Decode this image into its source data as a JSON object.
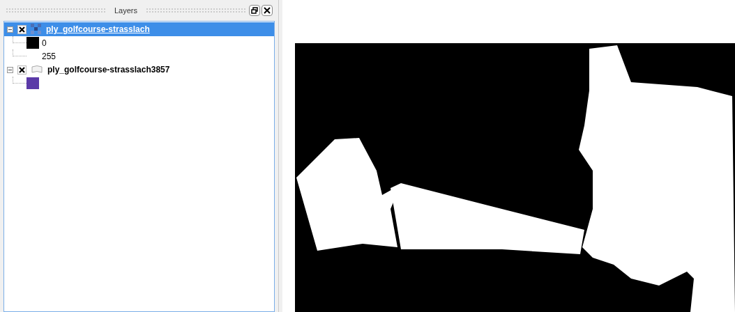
{
  "layers_panel": {
    "title": "Layers",
    "layers": [
      {
        "name": "ply_golfcourse-strasslach",
        "selected": true,
        "checked": true,
        "expanded": true,
        "kind": "raster",
        "legend": [
          {
            "label": "0",
            "color": "#000000"
          },
          {
            "label": "255"
          }
        ]
      },
      {
        "name": "ply_golfcourse-strasslach3857",
        "selected": false,
        "checked": true,
        "expanded": true,
        "kind": "polygon",
        "legend": [
          {
            "color": "#5b3aa8"
          }
        ]
      }
    ]
  }
}
